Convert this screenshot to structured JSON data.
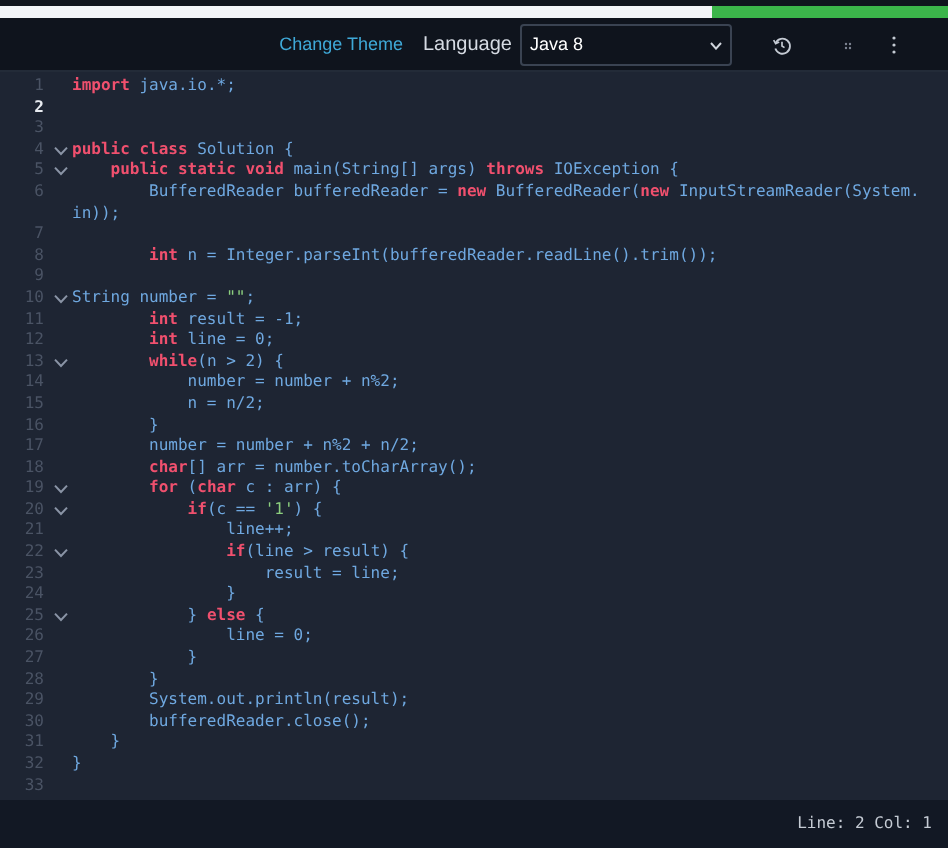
{
  "progress": {
    "level": 0.75
  },
  "toolbar": {
    "change_theme": "Change Theme",
    "language_label": "Language",
    "language_value": "Java 8"
  },
  "editor": {
    "lines": [
      {
        "number": "1",
        "fold": false,
        "current": false,
        "tokens": [
          {
            "kind": "kw",
            "text": "import"
          },
          {
            "kind": "id",
            "text": " java.io.*;"
          }
        ]
      },
      {
        "number": "2",
        "fold": false,
        "current": true
      },
      {
        "number": "3",
        "fold": false,
        "current": false
      },
      {
        "number": "4",
        "fold": true,
        "current": false,
        "tokens": [
          {
            "kind": "kw",
            "text": "public class"
          },
          {
            "kind": "id",
            "text": " Solution {"
          }
        ]
      },
      {
        "number": "5",
        "fold": true,
        "current": false,
        "tokens": [
          {
            "kind": "kw",
            "text": "    public static void"
          },
          {
            "kind": "id",
            "text": " main(String[] args) "
          },
          {
            "kind": "kw",
            "text": "throws"
          },
          {
            "kind": "id",
            "text": " IOException {"
          }
        ]
      },
      {
        "number": "6",
        "fold": false,
        "current": false,
        "tokens": [
          {
            "kind": "id",
            "text": "        BufferedReader bufferedReader = "
          },
          {
            "kind": "kw",
            "text": "new"
          },
          {
            "kind": "id",
            "text": " BufferedReader("
          },
          {
            "kind": "kw",
            "text": "new"
          },
          {
            "kind": "id",
            "text": " InputStreamReader(System."
          }
        ],
        "continuation": [
          {
            "kind": "id",
            "text": "in));"
          }
        ]
      },
      {
        "number": "7",
        "fold": false,
        "current": false
      },
      {
        "number": "8",
        "fold": false,
        "current": false,
        "tokens": [
          {
            "kind": "kw",
            "text": "        int"
          },
          {
            "kind": "id",
            "text": " n = Integer.parseInt(bufferedReader.readLine().trim());"
          }
        ]
      },
      {
        "number": "9",
        "fold": false,
        "current": false
      },
      {
        "number": "10",
        "fold": true,
        "current": false,
        "tokens": [
          {
            "kind": "id",
            "text": "String number = "
          },
          {
            "kind": "str",
            "text": "\"\""
          },
          {
            "kind": "id",
            "text": ";"
          }
        ]
      },
      {
        "number": "11",
        "fold": false,
        "current": false,
        "tokens": [
          {
            "kind": "kw",
            "text": "        int"
          },
          {
            "kind": "id",
            "text": " result = -1;"
          }
        ]
      },
      {
        "number": "12",
        "fold": false,
        "current": false,
        "tokens": [
          {
            "kind": "kw",
            "text": "        int"
          },
          {
            "kind": "id",
            "text": " line = 0;"
          }
        ]
      },
      {
        "number": "13",
        "fold": true,
        "current": false,
        "tokens": [
          {
            "kind": "kw",
            "text": "        while"
          },
          {
            "kind": "id",
            "text": "(n > 2) {"
          }
        ]
      },
      {
        "number": "14",
        "fold": false,
        "current": false,
        "tokens": [
          {
            "kind": "id",
            "text": "            number = number + n%2;"
          }
        ]
      },
      {
        "number": "15",
        "fold": false,
        "current": false,
        "tokens": [
          {
            "kind": "id",
            "text": "            n = n/2;"
          }
        ]
      },
      {
        "number": "16",
        "fold": false,
        "current": false,
        "tokens": [
          {
            "kind": "id",
            "text": "        }"
          }
        ]
      },
      {
        "number": "17",
        "fold": false,
        "current": false,
        "tokens": [
          {
            "kind": "id",
            "text": "        number = number + n%2 + n/2;"
          }
        ]
      },
      {
        "number": "18",
        "fold": false,
        "current": false,
        "tokens": [
          {
            "kind": "kw",
            "text": "        char"
          },
          {
            "kind": "id",
            "text": "[] arr = number.toCharArray();"
          }
        ]
      },
      {
        "number": "19",
        "fold": true,
        "current": false,
        "tokens": [
          {
            "kind": "kw",
            "text": "        for"
          },
          {
            "kind": "id",
            "text": " ("
          },
          {
            "kind": "kw",
            "text": "char"
          },
          {
            "kind": "id",
            "text": " c : arr) {"
          }
        ]
      },
      {
        "number": "20",
        "fold": true,
        "current": false,
        "tokens": [
          {
            "kind": "kw",
            "text": "            if"
          },
          {
            "kind": "id",
            "text": "(c == "
          },
          {
            "kind": "str",
            "text": "'1'"
          },
          {
            "kind": "id",
            "text": ") {"
          }
        ]
      },
      {
        "number": "21",
        "fold": false,
        "current": false,
        "tokens": [
          {
            "kind": "id",
            "text": "                line++;"
          }
        ]
      },
      {
        "number": "22",
        "fold": true,
        "current": false,
        "tokens": [
          {
            "kind": "kw",
            "text": "                if"
          },
          {
            "kind": "id",
            "text": "(line > result) {"
          }
        ]
      },
      {
        "number": "23",
        "fold": false,
        "current": false,
        "tokens": [
          {
            "kind": "id",
            "text": "                    result = line;"
          }
        ]
      },
      {
        "number": "24",
        "fold": false,
        "current": false,
        "tokens": [
          {
            "kind": "id",
            "text": "                }"
          }
        ]
      },
      {
        "number": "25",
        "fold": true,
        "current": false,
        "tokens": [
          {
            "kind": "id",
            "text": "            } "
          },
          {
            "kind": "kw",
            "text": "else"
          },
          {
            "kind": "id",
            "text": " {"
          }
        ]
      },
      {
        "number": "26",
        "fold": false,
        "current": false,
        "tokens": [
          {
            "kind": "id",
            "text": "                line = 0;"
          }
        ]
      },
      {
        "number": "27",
        "fold": false,
        "current": false,
        "tokens": [
          {
            "kind": "id",
            "text": "            }"
          }
        ]
      },
      {
        "number": "28",
        "fold": false,
        "current": false,
        "tokens": [
          {
            "kind": "id",
            "text": "        }"
          }
        ]
      },
      {
        "number": "29",
        "fold": false,
        "current": false,
        "tokens": [
          {
            "kind": "id",
            "text": "        System.out.println(result);"
          }
        ]
      },
      {
        "number": "30",
        "fold": false,
        "current": false,
        "tokens": [
          {
            "kind": "id",
            "text": "        bufferedReader.close();"
          }
        ]
      },
      {
        "number": "31",
        "fold": false,
        "current": false,
        "tokens": [
          {
            "kind": "id",
            "text": "    }"
          }
        ]
      },
      {
        "number": "32",
        "fold": false,
        "current": false,
        "tokens": [
          {
            "kind": "id",
            "text": "}"
          }
        ]
      },
      {
        "number": "33",
        "fold": false,
        "current": false
      }
    ]
  },
  "status_bar": {
    "position": "Line: 2 Col: 1"
  }
}
